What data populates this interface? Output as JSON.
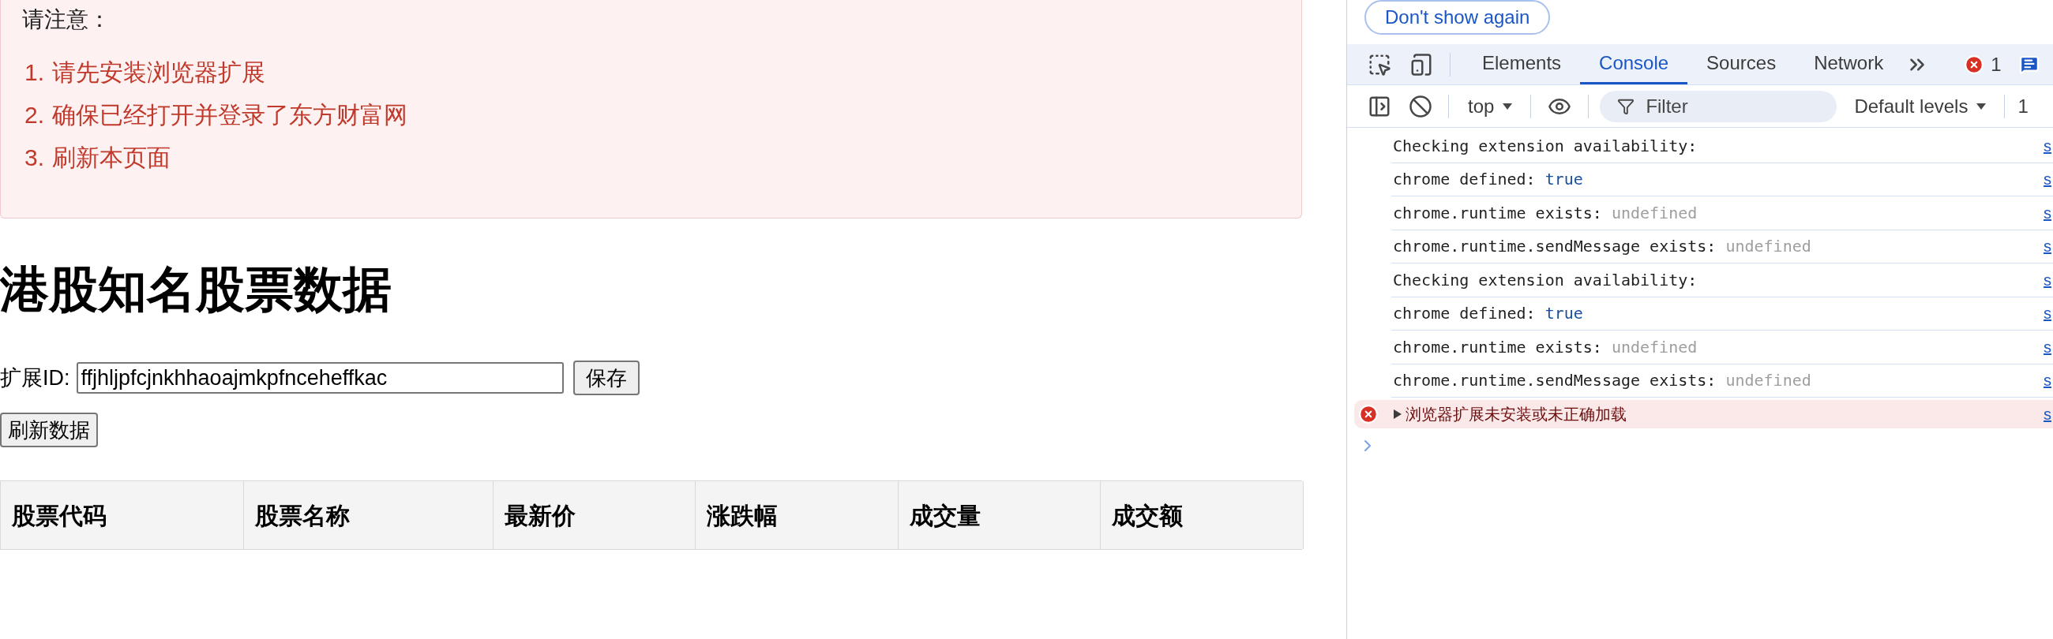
{
  "notice": {
    "title": "请注意：",
    "items": [
      {
        "number": "1.",
        "text": "请先安装浏览器扩展"
      },
      {
        "number": "2.",
        "text": "确保已经打开并登录了东方财富网"
      },
      {
        "number": "3.",
        "text": "刷新本页面"
      }
    ]
  },
  "heading": "港股知名股票数据",
  "extension": {
    "label": "扩展ID:",
    "value": "ffjhljpfcjnkhhaoajmkpfnceheffkac",
    "save_button": "保存"
  },
  "refresh_button": "刷新数据",
  "table": {
    "columns": [
      "股票代码",
      "股票名称",
      "最新价",
      "涨跌幅",
      "成交量",
      "成交额"
    ]
  },
  "devtools": {
    "banner_button": "Don't show again",
    "tabs": [
      {
        "label": "Elements",
        "selected": false
      },
      {
        "label": "Console",
        "selected": true
      },
      {
        "label": "Sources",
        "selected": false
      },
      {
        "label": "Network",
        "selected": false
      }
    ],
    "error_count": "1",
    "context": "top",
    "filter_placeholder": "Filter",
    "levels": "Default levels",
    "issues_count": "1",
    "messages": [
      {
        "kind": "log",
        "text": "Checking extension availability:",
        "source": "s"
      },
      {
        "kind": "log",
        "text": "chrome defined:",
        "value": {
          "text": "true",
          "color": "#1a4ea0"
        },
        "source": "s"
      },
      {
        "kind": "log",
        "text": "chrome.runtime exists:",
        "value": {
          "text": "undefined",
          "color": "#9e9e9e"
        },
        "source": "s"
      },
      {
        "kind": "log",
        "text": "chrome.runtime.sendMessage exists:",
        "value": {
          "text": "undefined",
          "color": "#9e9e9e"
        },
        "source": "s"
      },
      {
        "kind": "log",
        "text": "Checking extension availability:",
        "source": "s"
      },
      {
        "kind": "log",
        "text": "chrome defined:",
        "value": {
          "text": "true",
          "color": "#1a4ea0"
        },
        "source": "s"
      },
      {
        "kind": "log",
        "text": "chrome.runtime exists:",
        "value": {
          "text": "undefined",
          "color": "#9e9e9e"
        },
        "source": "s"
      },
      {
        "kind": "log",
        "text": "chrome.runtime.sendMessage exists:",
        "value": {
          "text": "undefined",
          "color": "#9e9e9e"
        },
        "source": "s"
      },
      {
        "kind": "error",
        "text": "浏览器扩展未安装或未正确加载",
        "expanded": false,
        "source": "s"
      }
    ]
  }
}
